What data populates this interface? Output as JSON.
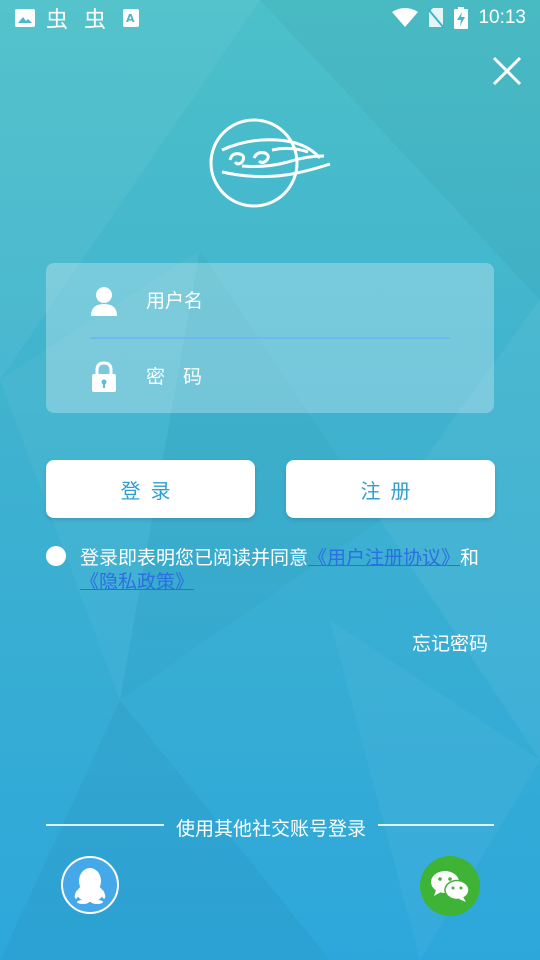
{
  "status_bar": {
    "time": "10:13"
  },
  "form": {
    "username_placeholder": "用户名",
    "password_placeholder": "密 码"
  },
  "buttons": {
    "login": "登录",
    "register": "注册"
  },
  "agreement": {
    "prefix": "登录即表明您已阅读并同意",
    "user_agreement_link": "《用户注册协议》",
    "conjunction": "和",
    "privacy_link": "《隐私政策》"
  },
  "forgot_password": "忘记密码",
  "social": {
    "title": "使用其他社交账号登录"
  },
  "colors": {
    "background_top": "#4cc0c9",
    "background_bottom": "#2da7db",
    "button_text": "#2f9fd2",
    "link": "#2b6fe0",
    "wechat_green": "#3fb336",
    "qq_blue": "#45a8e9"
  },
  "icons": [
    "image-icon",
    "bug-icon",
    "keyboard-icon",
    "wifi-icon",
    "no-sim-icon",
    "battery-charging-icon",
    "close-icon",
    "app-logo-icon",
    "user-icon",
    "lock-icon",
    "qq-icon",
    "wechat-icon"
  ]
}
